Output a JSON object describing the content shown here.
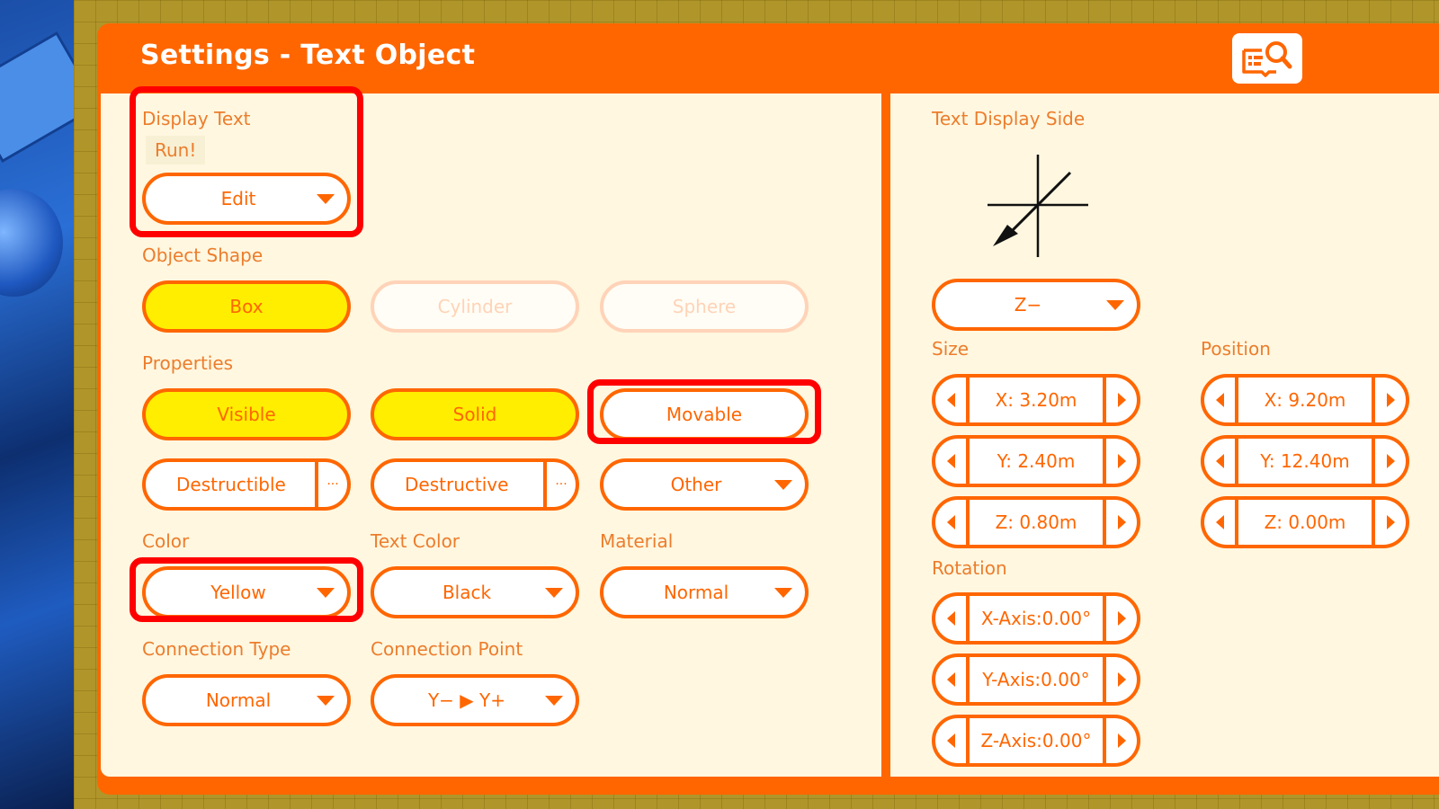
{
  "window": {
    "title": "Settings - Text Object",
    "help_icon": "help-book-search-icon"
  },
  "display_text": {
    "label": "Display Text",
    "value": "Run!",
    "edit_label": "Edit"
  },
  "object_shape": {
    "label": "Object Shape",
    "options": [
      "Box",
      "Cylinder",
      "Sphere"
    ],
    "selected": "Box"
  },
  "properties": {
    "label": "Properties",
    "visible": "Visible",
    "solid": "Solid",
    "movable": "Movable",
    "destructible": "Destructible",
    "destructive": "Destructive",
    "other": "Other",
    "more": "···"
  },
  "color": {
    "label": "Color",
    "value": "Yellow"
  },
  "text_color": {
    "label": "Text Color",
    "value": "Black"
  },
  "material": {
    "label": "Material",
    "value": "Normal"
  },
  "connection_type": {
    "label": "Connection Type",
    "value": "Normal"
  },
  "connection_point": {
    "label": "Connection Point",
    "value": "Y− ▶ Y+"
  },
  "text_display_side": {
    "label": "Text Display Side",
    "value": "Z−"
  },
  "size": {
    "label": "Size",
    "x": "X: 3.20m",
    "y": "Y: 2.40m",
    "z": "Z: 0.80m"
  },
  "position": {
    "label": "Position",
    "x": "X: 9.20m",
    "y": "Y: 12.40m",
    "z": "Z: 0.00m"
  },
  "rotation": {
    "label": "Rotation",
    "x": "X-Axis:0.00°",
    "y": "Y-Axis:0.00°",
    "z": "Z-Axis:0.00°"
  },
  "colors": {
    "accent": "#ff6600",
    "selected": "#ffee00",
    "panel": "#fff7e0",
    "highlight": "#ff0000"
  }
}
